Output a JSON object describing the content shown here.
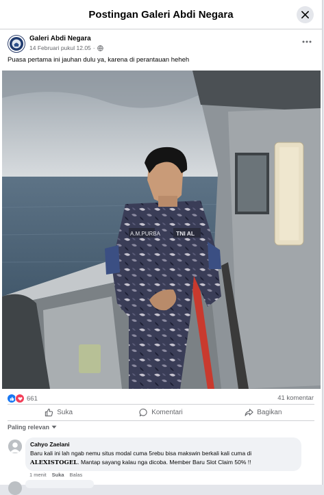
{
  "dialog": {
    "title": "Postingan Galeri Abdi Negara"
  },
  "post": {
    "author": "Galeri Abdi Negara",
    "timestamp": "14 Februari pukul 12.05",
    "separator": "·",
    "caption": "Puasa pertama ini jauhan dulu ya, karena di perantauan heheh",
    "uniform_patch_name": "A.M.PURBA",
    "uniform_patch_unit": "TNI AL"
  },
  "stats": {
    "reaction_count": "661",
    "comments_label": "41 komentar"
  },
  "actions": {
    "like": "Suka",
    "comment": "Komentari",
    "share": "Bagikan"
  },
  "sort": {
    "label": "Paling relevan"
  },
  "comment": {
    "author": "Cahyo Zaelani",
    "text_before": "Baru kali ini lah ngab nemu situs modal cuma 5rebu bisa makswin berkali kali cuma di ",
    "text_bold": "ALEXISTOGEL",
    "text_after": ". Mantap sayang kalau nga dicoba. Member Baru Slot Claim 50% !!",
    "time": "1 menit",
    "like": "Suka",
    "reply": "Balas"
  },
  "colors": {
    "accent": "#1877f2",
    "like_blue": "#1877f2",
    "love_red": "#f33e58",
    "secondary_text": "#65676b"
  },
  "icons": [
    "close-icon",
    "globe-icon",
    "more-icon",
    "like-reaction-icon",
    "love-reaction-icon",
    "thumbs-up-icon",
    "comment-icon",
    "share-icon",
    "chevron-down-icon"
  ]
}
